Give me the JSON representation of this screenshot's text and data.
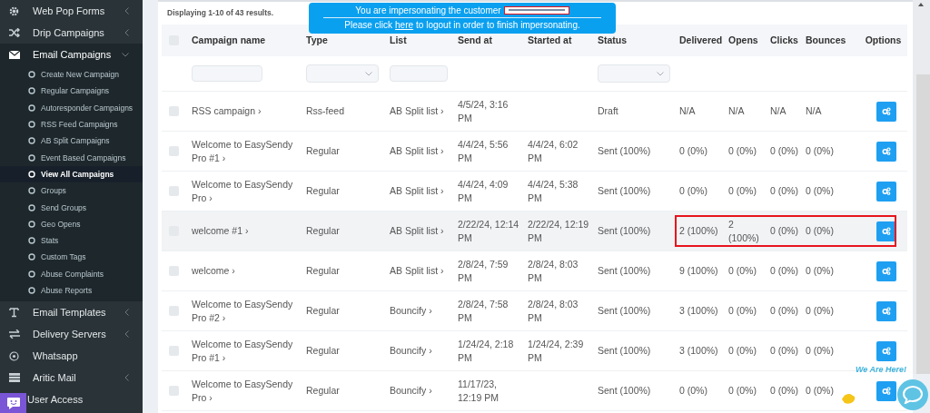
{
  "sidebar": {
    "items": [
      {
        "label": "Web Pop Forms",
        "kind": "menu",
        "expanded": false
      },
      {
        "label": "Drip Campaigns",
        "kind": "menu",
        "expanded": false
      },
      {
        "label": "Email Campaigns",
        "kind": "menu",
        "expanded": true,
        "children": [
          {
            "label": "Create New Campaign",
            "selected": false
          },
          {
            "label": "Regular Campaigns",
            "selected": false
          },
          {
            "label": "Autoresponder Campaigns",
            "selected": false
          },
          {
            "label": "RSS Feed Campaigns",
            "selected": false
          },
          {
            "label": "AB Split Campaigns",
            "selected": false
          },
          {
            "label": "Event Based Campaigns",
            "selected": false
          },
          {
            "label": "View All Campaigns",
            "selected": true
          },
          {
            "label": "Groups",
            "selected": false
          },
          {
            "label": "Send Groups",
            "selected": false
          },
          {
            "label": "Geo Opens",
            "selected": false
          },
          {
            "label": "Stats",
            "selected": false
          },
          {
            "label": "Custom Tags",
            "selected": false
          },
          {
            "label": "Abuse Complaints",
            "selected": false
          },
          {
            "label": "Abuse Reports",
            "selected": false
          }
        ]
      },
      {
        "label": "Email Templates",
        "kind": "menu",
        "expanded": false
      },
      {
        "label": "Delivery Servers",
        "kind": "menu",
        "expanded": false
      },
      {
        "label": "Whatsapp",
        "kind": "link"
      },
      {
        "label": "Aritic Mail",
        "kind": "menu",
        "expanded": false
      },
      {
        "label": "User Access",
        "kind": "link"
      }
    ]
  },
  "banner": {
    "line_1": "You are impersonating the customer",
    "line_2_before": "Please click",
    "link": "here",
    "line_2_after": "to logout in order to finish impersonating."
  },
  "summary": "Displaying 1-10 of 43 results.",
  "table": {
    "header_checked": false,
    "columns": [
      "Campaign name",
      "Type",
      "List",
      "Send at",
      "Started at",
      "Status",
      "Delivered",
      "Opens",
      "Clicks",
      "Bounces",
      "Options"
    ],
    "filters": [
      {
        "kind": "input"
      },
      {
        "kind": "select"
      },
      {
        "kind": "input"
      },
      {
        "kind": "none"
      },
      {
        "kind": "none"
      },
      {
        "kind": "select"
      },
      {
        "kind": "none"
      },
      {
        "kind": "none"
      },
      {
        "kind": "none"
      },
      {
        "kind": "none"
      },
      {
        "kind": "none"
      }
    ],
    "rows": [
      {
        "checked": false,
        "hovered": false,
        "outlined": false,
        "name": "RSS campaign ›",
        "type": "Rss-feed",
        "list": "AB Split list ›",
        "send_at": "4/5/24, 3:16 PM",
        "status": "Draft",
        "delivered": "N/A",
        "opens": "N/A",
        "clicks": "N/A",
        "bounces": "N/A"
      },
      {
        "checked": false,
        "hovered": false,
        "outlined": false,
        "name": "Welcome to EasySendy Pro #1 ›",
        "type": "Regular",
        "list": "AB Split list ›",
        "send_at": "4/4/24, 5:56 PM",
        "started_at": "4/4/24, 6:02 PM",
        "status": "Sent (100%)",
        "delivered": "0 (0%)",
        "opens": "0 (0%)",
        "clicks": "0 (0%)",
        "bounces": "0 (0%)"
      },
      {
        "checked": false,
        "hovered": false,
        "outlined": false,
        "name": "Welcome to EasySendy Pro ›",
        "type": "Regular",
        "list": "AB Split list ›",
        "send_at": "4/4/24, 4:09 PM",
        "started_at": "4/4/24, 5:38 PM",
        "status": "Sent (100%)",
        "delivered": "0 (0%)",
        "opens": "0 (0%)",
        "clicks": "0 (0%)",
        "bounces": "0 (0%)"
      },
      {
        "checked": false,
        "hovered": true,
        "outlined": true,
        "name": "welcome #1 ›",
        "type": "Regular",
        "list": "AB Split list ›",
        "send_at": "2/22/24, 12:14 PM",
        "started_at": "2/22/24, 12:19 PM",
        "status": "Sent (100%)",
        "delivered": "2 (100%)",
        "opens": "2 (100%)",
        "clicks": "0 (0%)",
        "bounces": "0 (0%)"
      },
      {
        "checked": false,
        "hovered": false,
        "outlined": false,
        "name": "welcome ›",
        "type": "Regular",
        "list": "AB Split list ›",
        "send_at": "2/8/24, 7:59 PM",
        "started_at": "2/8/24, 8:03 PM",
        "status": "Sent (100%)",
        "delivered": "9 (100%)",
        "opens": "0 (0%)",
        "clicks": "0 (0%)",
        "bounces": "0 (0%)"
      },
      {
        "checked": false,
        "hovered": false,
        "outlined": false,
        "name": "Welcome to EasySendy Pro #2 ›",
        "type": "Regular",
        "list": "Bouncify ›",
        "send_at": "2/8/24, 7:58 PM",
        "started_at": "2/8/24, 8:03 PM",
        "status": "Sent (100%)",
        "delivered": "3 (100%)",
        "opens": "0 (0%)",
        "clicks": "0 (0%)",
        "bounces": "0 (0%)"
      },
      {
        "checked": false,
        "hovered": false,
        "outlined": false,
        "name": "Welcome to EasySendy Pro #1 ›",
        "type": "Regular",
        "list": "Bouncify ›",
        "send_at": "1/24/24, 2:18 PM",
        "started_at": "1/24/24, 2:39 PM",
        "status": "Sent (100%)",
        "delivered": "3 (100%)",
        "opens": "0 (0%)",
        "clicks": "0 (0%)",
        "bounces": "0 (0%)"
      },
      {
        "checked": false,
        "hovered": false,
        "outlined": false,
        "name": "Welcome to EasySendy Pro ›",
        "type": "Regular",
        "list": "Bouncify ›",
        "send_at": "11/17/23, 12:19 PM",
        "status": "Sent (100%)",
        "delivered": "0 (0%)",
        "opens": "0 (0%)",
        "clicks": "0 (0%)",
        "bounces": "0 (0%)"
      }
    ]
  },
  "chat_widget": {
    "label": "We Are Here!"
  }
}
